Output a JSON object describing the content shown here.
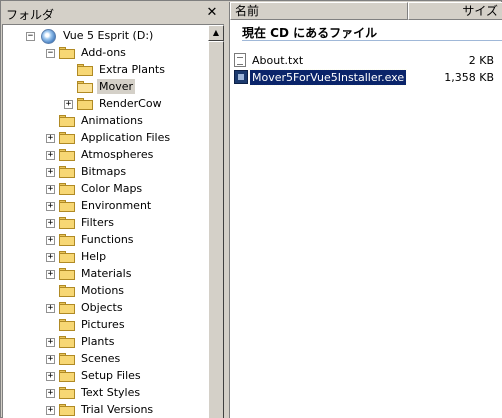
{
  "folder_pane": {
    "title": "フォルダ",
    "close_glyph": "✕",
    "tree": [
      {
        "label": "Vue 5 Esprit (D:)",
        "icon": "drive-icon",
        "expander": "−"
      },
      {
        "label": "Add-ons",
        "icon": "folder-icon",
        "expander": "−"
      },
      {
        "label": "Extra Plants",
        "icon": "folder-icon",
        "expander": ""
      },
      {
        "label": "Mover",
        "icon": "folder-open-icon",
        "expander": "",
        "selected": true
      },
      {
        "label": "RenderCow",
        "icon": "folder-icon",
        "expander": "+"
      },
      {
        "label": "Animations",
        "icon": "folder-icon",
        "expander": ""
      },
      {
        "label": "Application Files",
        "icon": "folder-icon",
        "expander": "+"
      },
      {
        "label": "Atmospheres",
        "icon": "folder-icon",
        "expander": "+"
      },
      {
        "label": "Bitmaps",
        "icon": "folder-icon",
        "expander": "+"
      },
      {
        "label": "Color Maps",
        "icon": "folder-icon",
        "expander": "+"
      },
      {
        "label": "Environment",
        "icon": "folder-icon",
        "expander": "+"
      },
      {
        "label": "Filters",
        "icon": "folder-icon",
        "expander": "+"
      },
      {
        "label": "Functions",
        "icon": "folder-icon",
        "expander": "+"
      },
      {
        "label": "Help",
        "icon": "folder-icon",
        "expander": "+"
      },
      {
        "label": "Materials",
        "icon": "folder-icon",
        "expander": "+"
      },
      {
        "label": "Motions",
        "icon": "folder-icon",
        "expander": ""
      },
      {
        "label": "Objects",
        "icon": "folder-icon",
        "expander": "+"
      },
      {
        "label": "Pictures",
        "icon": "folder-icon",
        "expander": ""
      },
      {
        "label": "Plants",
        "icon": "folder-icon",
        "expander": "+"
      },
      {
        "label": "Scenes",
        "icon": "folder-icon",
        "expander": "+"
      },
      {
        "label": "Setup Files",
        "icon": "folder-icon",
        "expander": "+"
      },
      {
        "label": "Text Styles",
        "icon": "folder-icon",
        "expander": "+"
      },
      {
        "label": "Trial Versions",
        "icon": "folder-icon",
        "expander": "+"
      }
    ]
  },
  "file_pane": {
    "columns": {
      "name": "名前",
      "size": "サイズ"
    },
    "group_header": "現在 CD にあるファイル",
    "files": [
      {
        "name": "About.txt",
        "size": "2 KB",
        "icon": "text-file-icon",
        "selected": false
      },
      {
        "name": "Mover5ForVue5Installer.exe",
        "size": "1,358 KB",
        "icon": "exe-file-icon",
        "selected": true
      }
    ]
  },
  "colors": {
    "selection": "#0a246a",
    "folder_fill": "#f7d774",
    "chrome": "#d4d0c8"
  }
}
